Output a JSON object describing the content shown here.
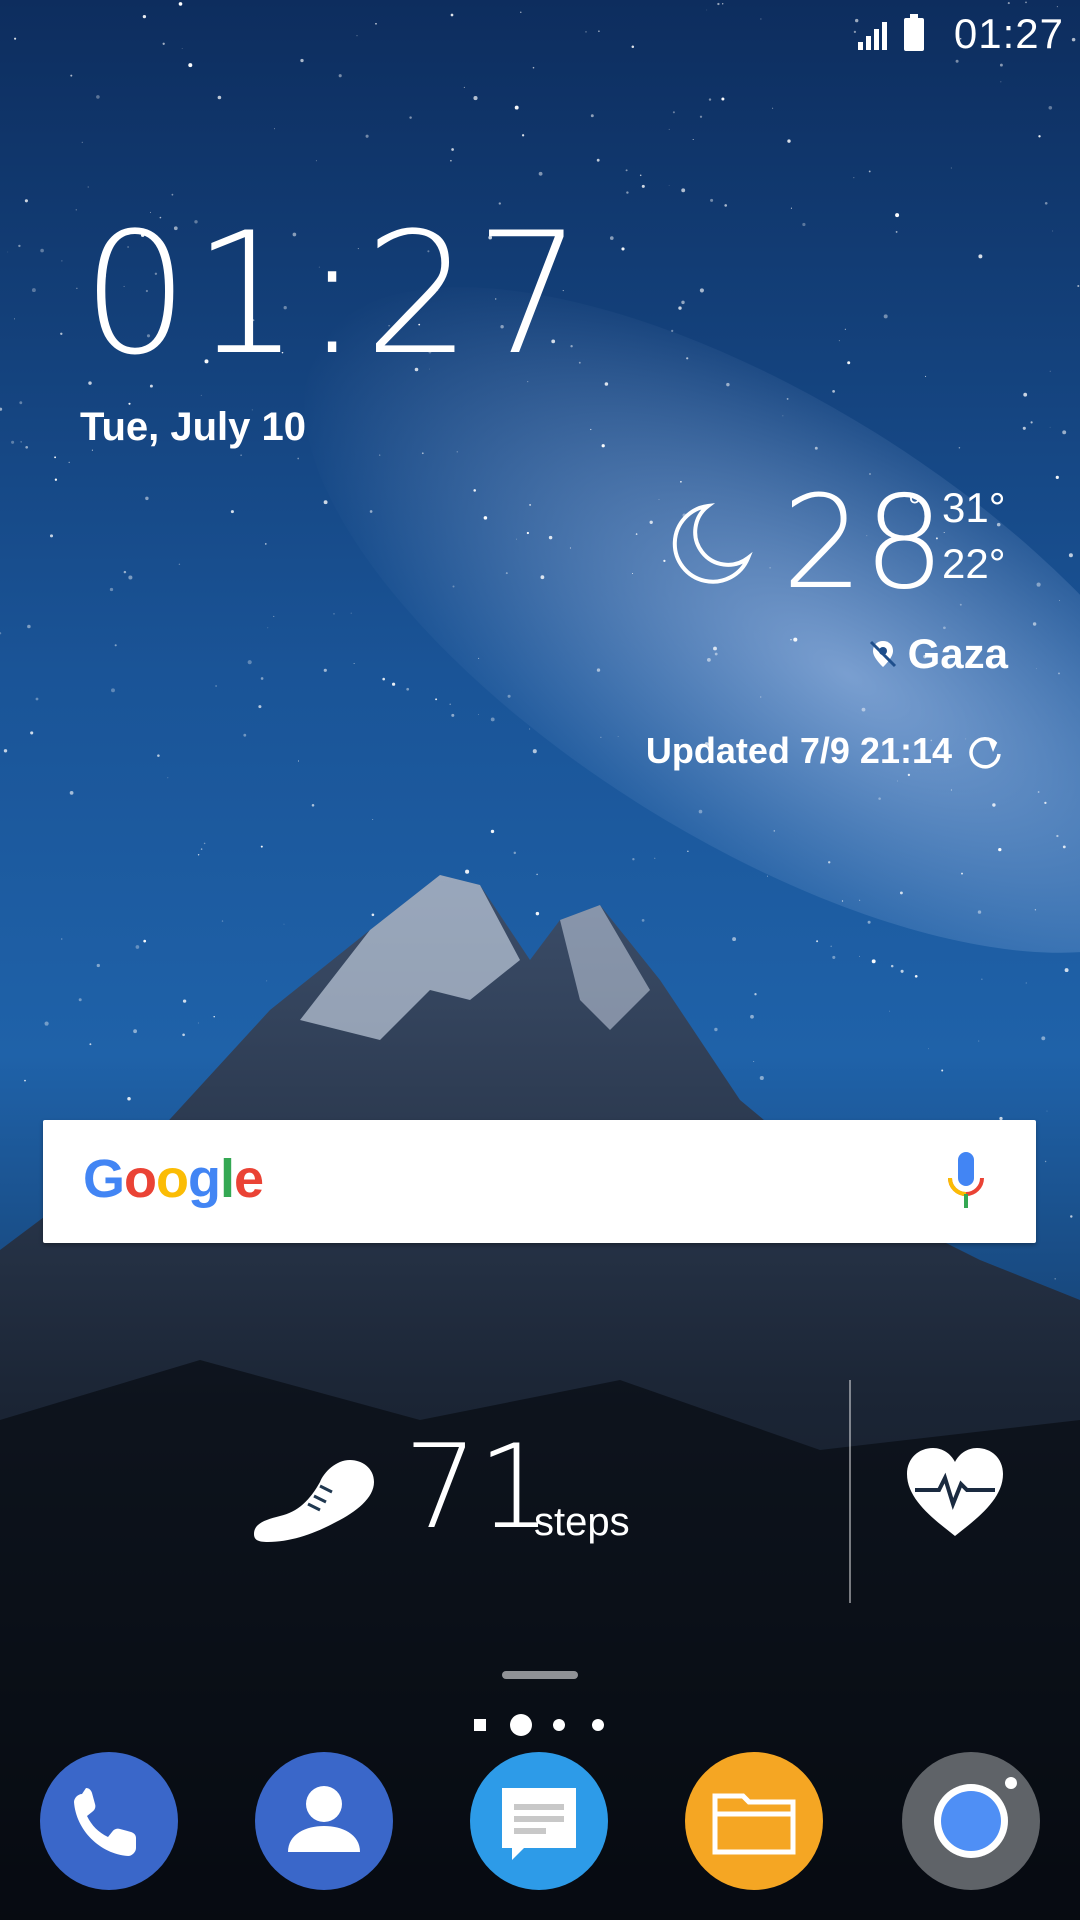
{
  "status_bar": {
    "time": "01:27",
    "signal_icon": "signal-icon",
    "battery_icon": "battery-icon"
  },
  "clock_widget": {
    "time": "01:27",
    "date": "Tue, July 10"
  },
  "weather_widget": {
    "condition_icon": "moon-icon",
    "temperature": "28",
    "degree_symbol": "°",
    "high": "31°",
    "low": "22°",
    "location": "Gaza",
    "location_icon": "location-pin-icon",
    "updated": "Updated 7/9 21:14",
    "refresh_icon": "refresh-icon"
  },
  "search_bar": {
    "logo_letters": [
      {
        "char": "G",
        "color": "#4285F4"
      },
      {
        "char": "o",
        "color": "#EA4335"
      },
      {
        "char": "o",
        "color": "#FBBC05"
      },
      {
        "char": "g",
        "color": "#4285F4"
      },
      {
        "char": "l",
        "color": "#34A853"
      },
      {
        "char": "e",
        "color": "#EA4335"
      }
    ],
    "mic_icon": "microphone-icon"
  },
  "health_widget": {
    "steps_icon": "shoe-icon",
    "steps_count": "71",
    "steps_label": "steps",
    "heart_icon": "heart-rate-icon"
  },
  "home_pages": {
    "count": 4,
    "active_index": 1
  },
  "dock": [
    {
      "app": "Phone",
      "icon": "phone-icon",
      "color": "#3a67c9"
    },
    {
      "app": "Contacts",
      "icon": "contacts-icon",
      "color": "#3a67c9"
    },
    {
      "app": "Messages",
      "icon": "messages-icon",
      "color": "#2d9be8"
    },
    {
      "app": "Files",
      "icon": "folder-icon",
      "color": "#f5a623"
    },
    {
      "app": "Camera",
      "icon": "camera-icon",
      "color": "#5f6368"
    }
  ]
}
